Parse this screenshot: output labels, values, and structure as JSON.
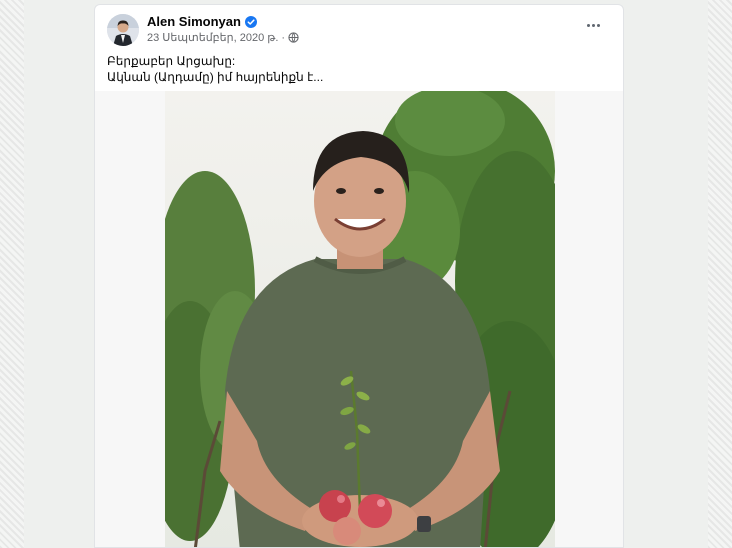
{
  "post": {
    "author": "Alen Simonyan",
    "date": "23 Սեպտեմբեր, 2020 թ.",
    "separator": "·",
    "text_line1": "Բերքաբեր Արցախը:",
    "text_line2": "Ակնան (Աղդամը) իմ հայրենիքն է..."
  },
  "icons": {
    "verified": "verified-badge-icon",
    "privacy": "globe-icon",
    "menu": "more-options-icon"
  },
  "colors": {
    "accent": "#1877f2",
    "text": "#050505",
    "muted": "#65676b",
    "shirt": "#5d6a52",
    "foliage": "#4f7d34"
  }
}
